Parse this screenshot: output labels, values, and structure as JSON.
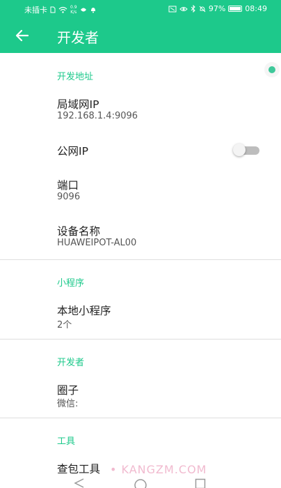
{
  "status_bar": {
    "carrier": "未插卡",
    "speed_value": "0.9",
    "speed_unit": "K/s",
    "battery": "97%",
    "time": "08:49",
    "battery_level": 0.97
  },
  "header": {
    "title": "开发者"
  },
  "sections": {
    "dev_address": {
      "header": "开发地址",
      "lan_ip_title": "局域网IP",
      "lan_ip_value": "192.168.1.4:9096",
      "public_ip_title": "公网IP",
      "public_ip_enabled": false,
      "port_title": "端口",
      "port_value": "9096",
      "device_name_title": "设备名称",
      "device_name_value": "HUAWEIPOT-AL00"
    },
    "mini_program": {
      "header": "小程序",
      "local_title": "本地小程序",
      "local_count": "2个"
    },
    "developer": {
      "header": "开发者",
      "circle_title": "圈子",
      "circle_sub": "微信:"
    },
    "tools": {
      "header": "工具",
      "packet_title": "查包工具"
    }
  },
  "watermark": "• KANGZM.COM",
  "colors": {
    "accent": "#1dc98b",
    "toggle_off": "#bdbdbd"
  }
}
